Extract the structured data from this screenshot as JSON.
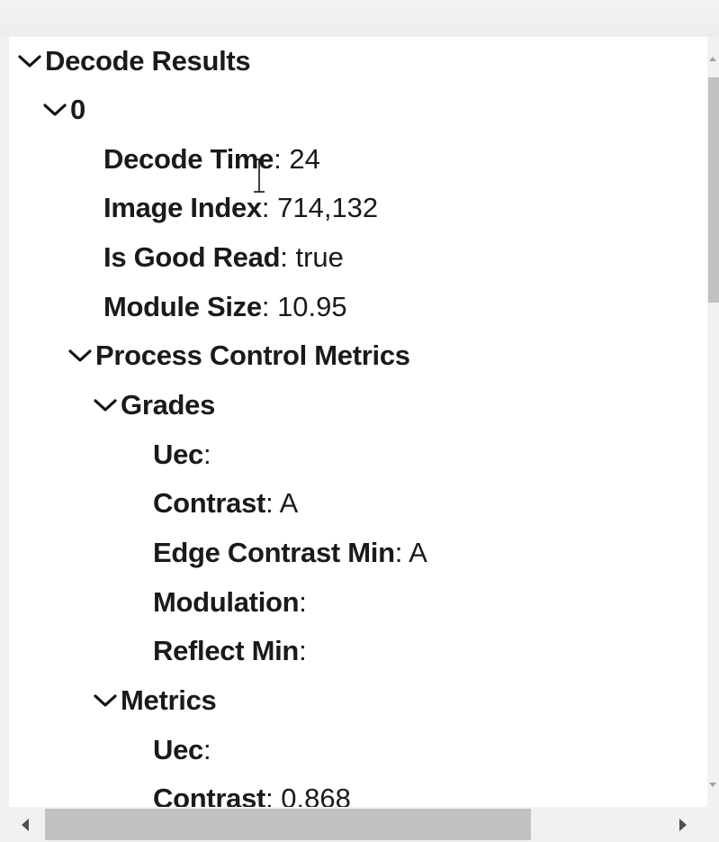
{
  "tree": {
    "root": {
      "label": "Decode Results"
    },
    "item0": {
      "label": "0"
    },
    "fields": [
      {
        "key": "Decode Time",
        "value": "24"
      },
      {
        "key": "Image Index",
        "value": "714,132"
      },
      {
        "key": "Is Good Read",
        "value": "true"
      },
      {
        "key": "Module Size",
        "value": "10.95"
      }
    ],
    "process_control": {
      "label": "Process Control Metrics"
    },
    "grades": {
      "label": "Grades",
      "items": [
        {
          "key": "Uec",
          "value": ""
        },
        {
          "key": "Contrast",
          "value": "A"
        },
        {
          "key": "Edge Contrast Min",
          "value": "A"
        },
        {
          "key": "Modulation",
          "value": ""
        },
        {
          "key": "Reflect Min",
          "value": ""
        }
      ]
    },
    "metrics": {
      "label": "Metrics",
      "items": [
        {
          "key": "Uec",
          "value": ""
        },
        {
          "key": "Contrast",
          "value": "0.868"
        }
      ]
    }
  },
  "separator": ": ",
  "icons": {
    "expand": "chevron-down-icon",
    "cursor": "text-cursor-icon"
  }
}
